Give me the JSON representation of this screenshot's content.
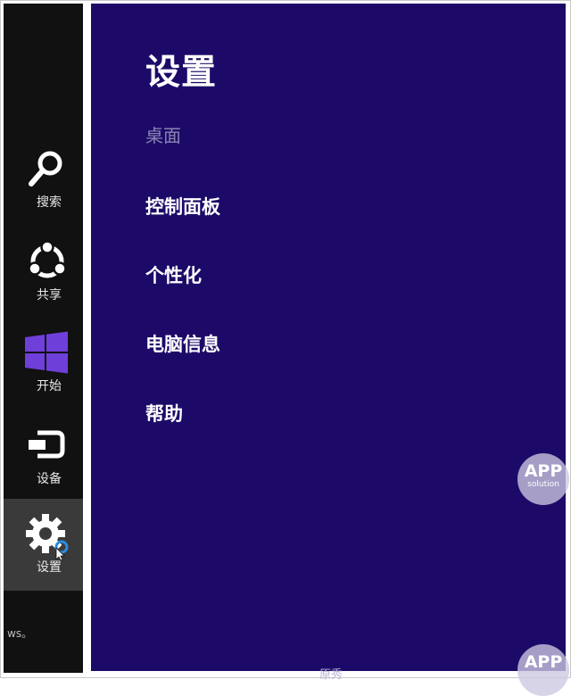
{
  "charms": [
    {
      "label": "搜索",
      "icon": "search-icon"
    },
    {
      "label": "共享",
      "icon": "share-icon"
    },
    {
      "label": "开始",
      "icon": "windows-logo-icon"
    },
    {
      "label": "设备",
      "icon": "devices-icon"
    },
    {
      "label": "设置",
      "icon": "gear-icon",
      "active": true
    }
  ],
  "charms_bar_bottom_text": "ws。",
  "settings_panel": {
    "title": "设置",
    "subtitle": "桌面",
    "items": [
      {
        "label": "控制面板"
      },
      {
        "label": "个性化"
      },
      {
        "label": "电脑信息"
      },
      {
        "label": "帮助"
      }
    ]
  },
  "watermark": {
    "big": "APP",
    "small": "solution"
  },
  "faint_bottom_text": "原秀",
  "colors": {
    "panel_background": "#1d0a68",
    "charms_background": "#111111",
    "active_charm_background": "#3a3a3a",
    "subtitle_text": "#8c84b3",
    "windows_logo": "#6f3fd9",
    "notification_dot": "#2b8de0"
  }
}
